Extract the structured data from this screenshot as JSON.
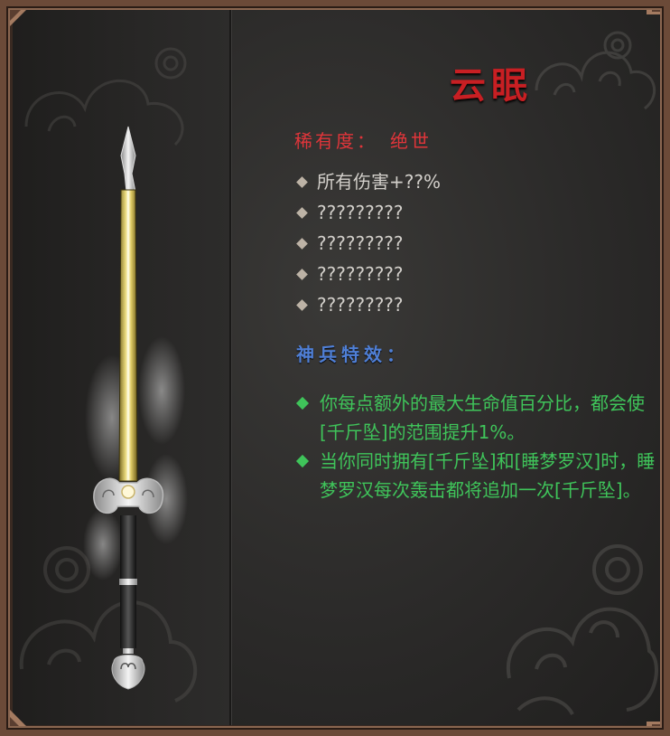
{
  "item": {
    "name": "云眠",
    "rarity_label": "稀有度：",
    "rarity_value": "绝世"
  },
  "attributes": [
    "所有伤害+??%",
    "?????????",
    "?????????",
    "?????????",
    "?????????"
  ],
  "special": {
    "heading": "神兵特效：",
    "effects": [
      "你每点额外的最大生命值百分比，都会使[千斤坠]的范围提升1%。",
      "当你同时拥有[千斤坠]和[睡梦罗汉]时，睡梦罗汉每次轰击都将追加一次[千斤坠]。"
    ]
  },
  "icons": {
    "weapon": "sword-icon",
    "attribute_bullet": "diamond-icon",
    "effect_bullet": "diamond-icon"
  },
  "colors": {
    "title": "#c81f23",
    "rarity": "#e0353a",
    "attribute_text": "#d2cfca",
    "special_heading": "#4f7fd6",
    "effect_text": "#3fc45a",
    "frame": "#6b4a38"
  }
}
